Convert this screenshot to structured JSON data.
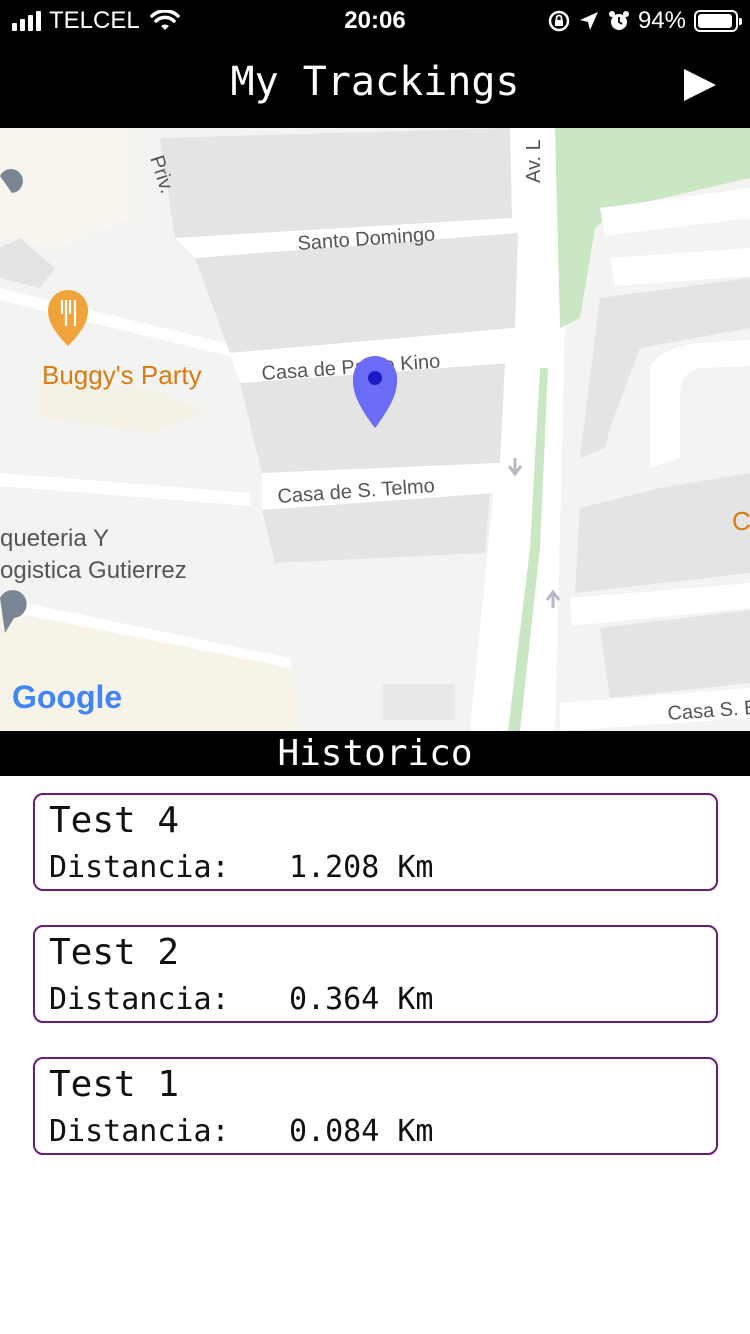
{
  "status_bar": {
    "carrier": "TELCEL",
    "time": "20:06",
    "battery": "94%",
    "battery_level": 0.94,
    "icons": [
      "signal-icon",
      "wifi-icon",
      "orientation-lock-icon",
      "location-arrow-icon",
      "alarm-icon",
      "battery-icon"
    ]
  },
  "header": {
    "title": "My Trackings",
    "action_icon": "play-icon"
  },
  "map": {
    "streets": [
      "Priv.",
      "Santo Domingo",
      "Casa de Padre Kino",
      "Casa de S. Telmo",
      "Av. L",
      "Casa S. E"
    ],
    "places": [
      "Buggy's Party",
      "queteria Y",
      "ogistica Gutierrez",
      "C"
    ],
    "attribution": "Google",
    "marker_icon": "location-pin-icon",
    "colors": {
      "marker": "#6b6cf5",
      "park": "#c9e7c3",
      "place_label": "#d97b11",
      "place_pin": "#f1a33b"
    }
  },
  "history": {
    "title": "Historico",
    "distance_label": "Distancia:",
    "items": [
      {
        "name": "Test 4",
        "distance": "1.208 Km"
      },
      {
        "name": "Test 2",
        "distance": "0.364 Km"
      },
      {
        "name": "Test 1",
        "distance": "0.084 Km"
      }
    ]
  }
}
